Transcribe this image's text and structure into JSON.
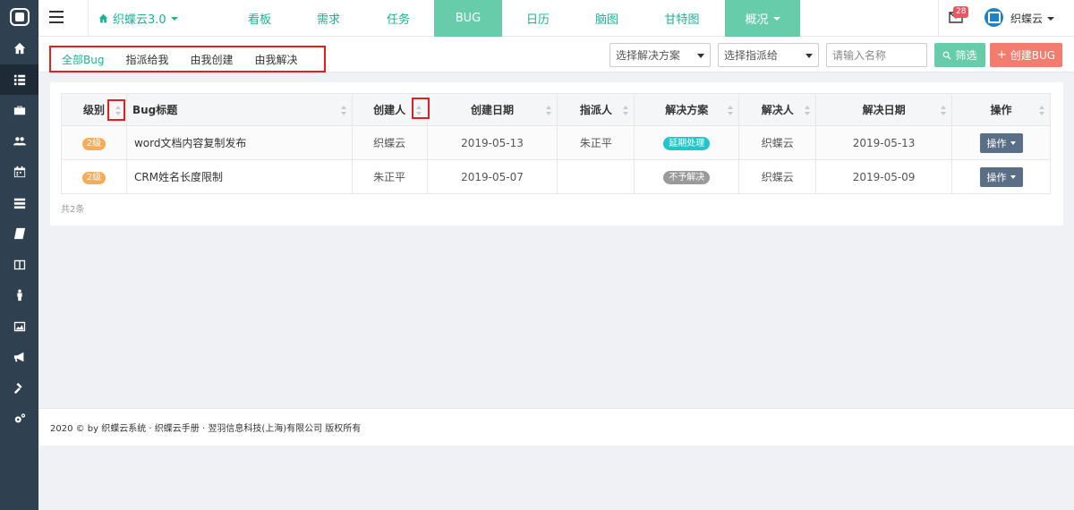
{
  "sidebar": {
    "items": [
      {
        "icon": "home-icon"
      },
      {
        "icon": "list-icon",
        "active": true
      },
      {
        "icon": "briefcase-icon"
      },
      {
        "icon": "users-icon"
      },
      {
        "icon": "calendar-icon"
      },
      {
        "icon": "tasks-icon"
      },
      {
        "icon": "book-icon"
      },
      {
        "icon": "columns-icon"
      },
      {
        "icon": "person-icon"
      },
      {
        "icon": "image-icon"
      },
      {
        "icon": "bullhorn-icon"
      },
      {
        "icon": "gavel-icon"
      },
      {
        "icon": "cogs-icon"
      }
    ]
  },
  "header": {
    "project": "织蝶云3.0",
    "tabs": [
      "看板",
      "需求",
      "任务",
      "BUG",
      "日历",
      "脑图",
      "甘特图",
      "概况"
    ],
    "active_tab": "BUG",
    "mail_count": "28",
    "username": "织蝶云"
  },
  "filter": {
    "subtabs": [
      "全部Bug",
      "指派给我",
      "由我创建",
      "由我解决"
    ],
    "active_subtab": "全部Bug",
    "solution_select": "选择解决方案",
    "assignee_select": "选择指派给",
    "name_placeholder": "请输入名称",
    "filter_button": "筛选",
    "create_button": "创建BUG"
  },
  "table": {
    "columns": [
      "级别",
      "Bug标题",
      "创建人",
      "创建日期",
      "指派人",
      "解决方案",
      "解决人",
      "解决日期",
      "操作"
    ],
    "rows": [
      {
        "level": "2级",
        "title": "word文档内容复制发布",
        "creator": "织蝶云",
        "created": "2019-05-13",
        "assignee": "朱正平",
        "solution": "延期处理",
        "solution_color": "#23c6c8",
        "resolver": "织蝶云",
        "resolved": "2019-05-13",
        "action": "操作"
      },
      {
        "level": "2级",
        "title": "CRM姓名长度限制",
        "creator": "朱正平",
        "created": "2019-05-07",
        "assignee": "",
        "solution": "不予解决",
        "solution_color": "#9a9a9a",
        "resolver": "织蝶云",
        "resolved": "2019-05-09",
        "action": "操作"
      }
    ],
    "total": "共2条"
  },
  "footer": {
    "text": "2020 © by 织蝶云系统 · 织蝶云手册 · 翌羽信息科技(上海)有限公司 版权所有"
  },
  "colors": {
    "accent": "#1ab394",
    "sidebar": "#2f4050",
    "create": "#f27d6f",
    "badge": "#ed5565"
  }
}
